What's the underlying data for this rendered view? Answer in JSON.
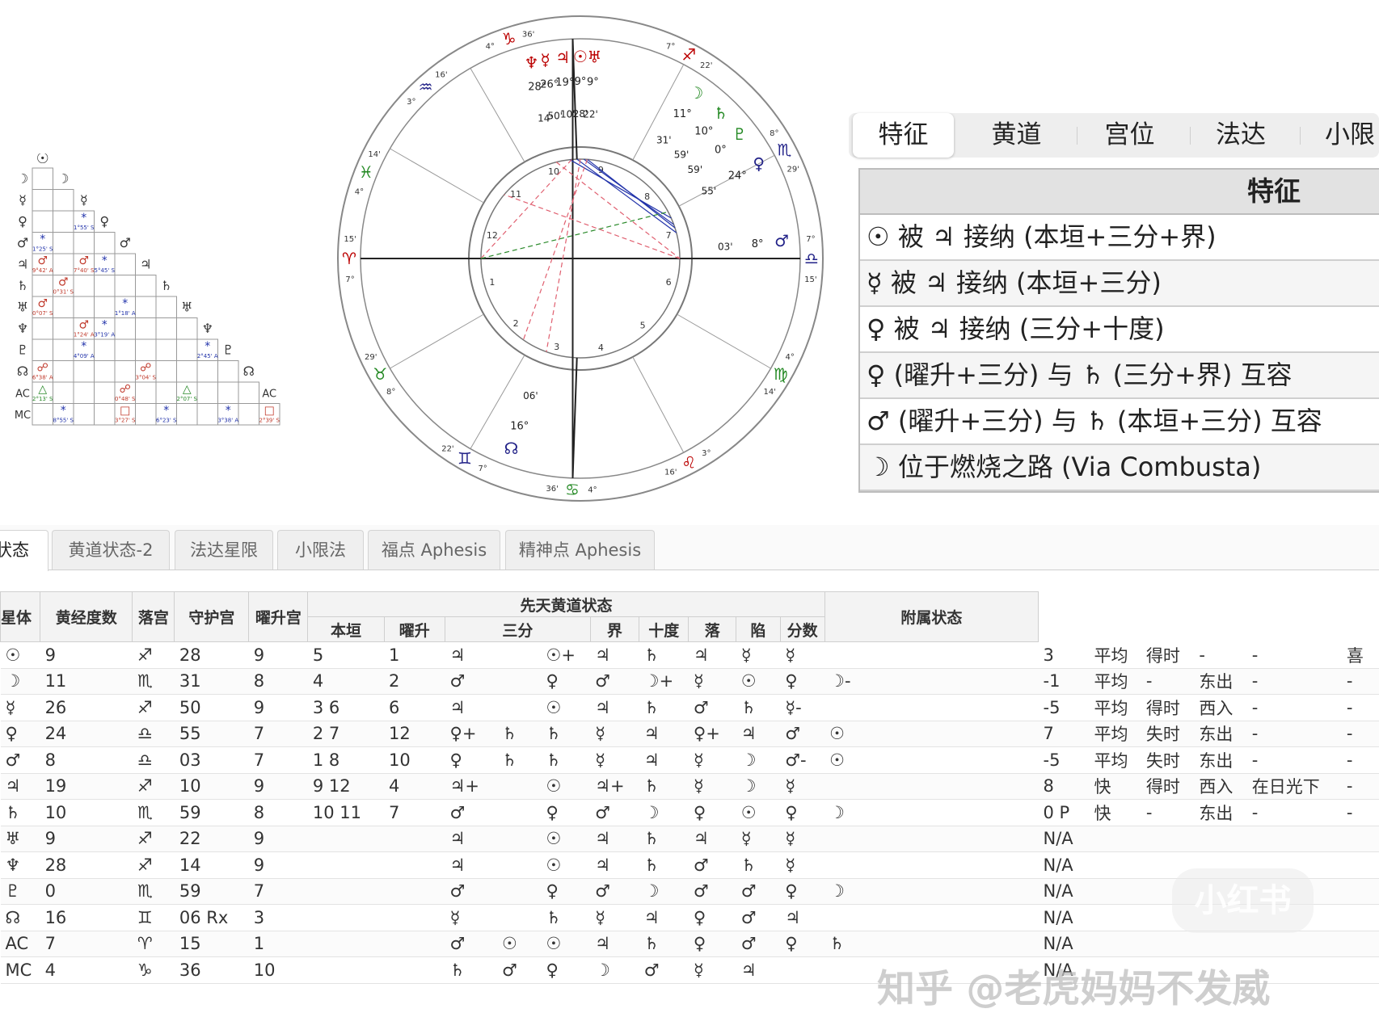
{
  "aspect_grid": {
    "planet_column": [
      "☽",
      "☿",
      "♀",
      "♂",
      "♃",
      "♄",
      "♅",
      "♆",
      "♇",
      "☊",
      "AC",
      "MC"
    ],
    "diagonal": [
      "☉",
      "☽",
      "☿",
      "♀",
      "♂",
      "♃",
      "♄",
      "♅",
      "♆",
      "♇",
      "☊",
      "AC"
    ],
    "cells": [
      {
        "r": 3,
        "c": 0,
        "g": "*",
        "t": "1°25' S",
        "k": "b"
      },
      {
        "r": 2,
        "c": 2,
        "g": "*",
        "t": "1°55' S",
        "k": "b"
      },
      {
        "r": 4,
        "c": 0,
        "g": "♂",
        "t": "9°42' A",
        "k": "r"
      },
      {
        "r": 4,
        "c": 2,
        "g": "♂",
        "t": "7°40' S",
        "k": "r"
      },
      {
        "r": 4,
        "c": 3,
        "g": "*",
        "t": "5°45' S",
        "k": "b"
      },
      {
        "r": 5,
        "c": 1,
        "g": "♂",
        "t": "0°31' S",
        "k": "r"
      },
      {
        "r": 6,
        "c": 0,
        "g": "♂",
        "t": "0°07' S",
        "k": "r"
      },
      {
        "r": 6,
        "c": 4,
        "g": "*",
        "t": "1°18' A",
        "k": "b"
      },
      {
        "r": 7,
        "c": 2,
        "g": "♂",
        "t": "1°24' A",
        "k": "r"
      },
      {
        "r": 7,
        "c": 3,
        "g": "*",
        "t": "3°19' A",
        "k": "b"
      },
      {
        "r": 8,
        "c": 2,
        "g": "*",
        "t": "4°09' A",
        "k": "b"
      },
      {
        "r": 8,
        "c": 8,
        "g": "*",
        "t": "2°45' A",
        "k": "b"
      },
      {
        "r": 9,
        "c": 0,
        "g": "☍",
        "t": "6°38' A",
        "k": "r"
      },
      {
        "r": 9,
        "c": 5,
        "g": "☍",
        "t": "3°04' S",
        "k": "r"
      },
      {
        "r": 10,
        "c": 0,
        "g": "△",
        "t": "2°13' S",
        "k": "g"
      },
      {
        "r": 10,
        "c": 4,
        "g": "☍",
        "t": "0°48' S",
        "k": "r"
      },
      {
        "r": 10,
        "c": 7,
        "g": "△",
        "t": "2°07' S",
        "k": "g"
      },
      {
        "r": 11,
        "c": 1,
        "g": "*",
        "t": "8°55' S",
        "k": "b"
      },
      {
        "r": 11,
        "c": 4,
        "g": "□",
        "t": "3°27' S",
        "k": "r"
      },
      {
        "r": 11,
        "c": 6,
        "g": "*",
        "t": "6°23' S",
        "k": "b"
      },
      {
        "r": 11,
        "c": 9,
        "g": "*",
        "t": "3°38' A",
        "k": "b"
      },
      {
        "r": 11,
        "c": 11,
        "g": "□",
        "t": "2°39' S",
        "k": "r"
      }
    ]
  },
  "wheel": {
    "sign_labels": [
      {
        "ang": 108,
        "g": "♑",
        "deg": "4°",
        "min": "36'",
        "c": "#b00"
      },
      {
        "ang": 132,
        "g": "♒",
        "deg": "3°",
        "min": "16'",
        "c": "#228"
      },
      {
        "ang": 158,
        "g": "♓",
        "deg": "4°",
        "min": "14'",
        "c": "#282"
      },
      {
        "ang": 180,
        "g": "♈",
        "deg": "7°",
        "min": "15'",
        "c": "#b00"
      },
      {
        "ang": 210,
        "g": "♉",
        "deg": "8°",
        "min": "29'",
        "c": "#282"
      },
      {
        "ang": 240,
        "g": "♊",
        "deg": "7°",
        "min": "22'",
        "c": "#228"
      },
      {
        "ang": 268,
        "g": "♋",
        "deg": "4°",
        "min": "36'",
        "c": "#282"
      },
      {
        "ang": 298,
        "g": "♌",
        "deg": "3°",
        "min": "16'",
        "c": "#b00"
      },
      {
        "ang": 330,
        "g": "♍",
        "deg": "4°",
        "min": "14'",
        "c": "#282"
      },
      {
        "ang": 0,
        "g": "♎",
        "deg": "7°",
        "min": "15'",
        "c": "#228"
      },
      {
        "ang": 28,
        "g": "♏",
        "deg": "8°",
        "min": "29'",
        "c": "#228"
      },
      {
        "ang": 62,
        "g": "♐",
        "deg": "7°",
        "min": "22'",
        "c": "#b00"
      }
    ],
    "house_numbers": [
      "1",
      "2",
      "3",
      "4",
      "5",
      "6",
      "7",
      "8",
      "9",
      "10",
      "11",
      "12"
    ],
    "planets": [
      {
        "g": "♆",
        "deg": "28°",
        "min": "14'",
        "c": "#b00"
      },
      {
        "g": "☿",
        "deg": "26°",
        "min": "50'",
        "c": "#b00"
      },
      {
        "g": "♃",
        "deg": "19°",
        "min": "10'",
        "c": "#b00"
      },
      {
        "g": "☉",
        "deg": "9°",
        "min": "28'",
        "c": "#b00"
      },
      {
        "g": "♅",
        "deg": "9°",
        "min": "22'",
        "c": "#b00"
      },
      {
        "g": "☽",
        "deg": "11°",
        "min": "31'",
        "c": "#282"
      },
      {
        "g": "♄",
        "deg": "10°",
        "min": "59'",
        "c": "#282"
      },
      {
        "g": "♇",
        "deg": "0°",
        "min": "59'",
        "c": "#282"
      },
      {
        "g": "♀",
        "deg": "24°",
        "min": "55'",
        "c": "#228"
      },
      {
        "g": "♂",
        "deg": "8°",
        "min": "03'",
        "c": "#228"
      },
      {
        "g": "☊",
        "deg": "16°",
        "min": "06'",
        "c": "#228"
      }
    ]
  },
  "feature_panel": {
    "tabs": [
      "特征",
      "黄道",
      "宫位",
      "法达",
      "小限"
    ],
    "active_tab": 0,
    "title": "特征",
    "rows": [
      "☉ 被 ♃ 接纳 (本垣+三分+界)",
      "☿ 被 ♃ 接纳 (本垣+三分)",
      "♀ 被 ♃ 接纳 (三分+十度)",
      "♀ (曜升+三分) 与 ♄ (三分+界) 互容",
      "♂ (曜升+三分) 与 ♄ (本垣+三分) 互容",
      "☽ 位于燃烧之路 (Via Combusta)"
    ]
  },
  "bottom_tabs": [
    "状态",
    "黄道状态-2",
    "法达星限",
    "小限法",
    "福点 Aphesis",
    "精神点 Aphesis"
  ],
  "status_table": {
    "headers": {
      "planet": "星体",
      "lon": "黄经度数",
      "house": "落宫",
      "rules": "守护宫",
      "exalt": "曜升宫",
      "group": "先天黄道状态",
      "sub": [
        "本垣",
        "曜升",
        "三分",
        "界",
        "十度",
        "落",
        "陷",
        "分数"
      ],
      "attached": "附属状态"
    },
    "rows": [
      [
        "☉",
        "9",
        "♐",
        "28",
        "9",
        "5",
        "1",
        "♃",
        "",
        "☉+",
        "♃",
        "♄",
        "♃",
        "☿",
        "☿",
        "",
        "3",
        "平均",
        "得时",
        "-",
        "-",
        "喜"
      ],
      [
        "☽",
        "11",
        "♏",
        "31",
        "8",
        "4",
        "2",
        "♂",
        "",
        "♀",
        "♂",
        "☽+",
        "☿",
        "☉",
        "♀",
        "☽-",
        "-1",
        "平均",
        "-",
        "东出",
        "-",
        "-"
      ],
      [
        "☿",
        "26",
        "♐",
        "50",
        "9",
        "3 6",
        "6",
        "♃",
        "",
        "☉",
        "♃",
        "♄",
        "♂",
        "♄",
        "☿-",
        "",
        "-5",
        "平均",
        "得时",
        "西入",
        "-",
        "-"
      ],
      [
        "♀",
        "24",
        "♎",
        "55",
        "7",
        "2 7",
        "12",
        "♀+",
        "♄",
        "♄",
        "☿",
        "♃",
        "♀+",
        "♃",
        "♂",
        "☉",
        "7",
        "平均",
        "失时",
        "东出",
        "-",
        "-"
      ],
      [
        "♂",
        "8",
        "♎",
        "03",
        "7",
        "1 8",
        "10",
        "♀",
        "♄",
        "♄",
        "☿",
        "♃",
        "☿",
        "☽",
        "♂-",
        "☉",
        "-5",
        "平均",
        "失时",
        "东出",
        "-",
        "-"
      ],
      [
        "♃",
        "19",
        "♐",
        "10",
        "9",
        "9 12",
        "4",
        "♃+",
        "",
        "☉",
        "♃+",
        "♄",
        "☿",
        "☽",
        "☿",
        "",
        "8",
        "快",
        "得时",
        "西入",
        "在日光下",
        "-"
      ],
      [
        "♄",
        "10",
        "♏",
        "59",
        "8",
        "10 11",
        "7",
        "♂",
        "",
        "♀",
        "♂",
        "☽",
        "♀",
        "☉",
        "♀",
        "☽",
        "0 P",
        "快",
        "-",
        "东出",
        "-",
        "-"
      ],
      [
        "♅",
        "9",
        "♐",
        "22",
        "9",
        "",
        "",
        "♃",
        "",
        "☉",
        "♃",
        "♄",
        "♃",
        "☿",
        "☿",
        "",
        "N/A",
        "",
        "",
        "",
        "",
        ""
      ],
      [
        "♆",
        "28",
        "♐",
        "14",
        "9",
        "",
        "",
        "♃",
        "",
        "☉",
        "♃",
        "♄",
        "♂",
        "♄",
        "☿",
        "",
        "N/A",
        "",
        "",
        "",
        "",
        ""
      ],
      [
        "♇",
        "0",
        "♏",
        "59",
        "7",
        "",
        "",
        "♂",
        "",
        "♀",
        "♂",
        "☽",
        "♂",
        "♂",
        "♀",
        "☽",
        "N/A",
        "",
        "",
        "",
        "",
        ""
      ],
      [
        "☊",
        "16",
        "♊",
        "06 Rx",
        "3",
        "",
        "",
        "☿",
        "",
        "♄",
        "☿",
        "♃",
        "♀",
        "♂",
        "♃",
        "",
        "N/A",
        "",
        "",
        "",
        "",
        ""
      ],
      [
        "AC",
        "7",
        "♈",
        "15",
        "1",
        "",
        "",
        "♂",
        "☉",
        "☉",
        "♃",
        "♄",
        "♀",
        "♂",
        "♀",
        "♄",
        "N/A",
        "",
        "",
        "",
        "",
        ""
      ],
      [
        "MC",
        "4",
        "♑",
        "36",
        "10",
        "",
        "",
        "♄",
        "♂",
        "♀",
        "☽",
        "♂",
        "☿",
        "♃",
        "",
        "",
        "N/A",
        "",
        "",
        "",
        "",
        ""
      ]
    ]
  },
  "watermark": "知乎 @老虎妈妈不发威",
  "watermark2": "小红书",
  "colors": {
    "red": "#c0392b",
    "blue": "#2233aa",
    "green": "#2a8a2a"
  }
}
